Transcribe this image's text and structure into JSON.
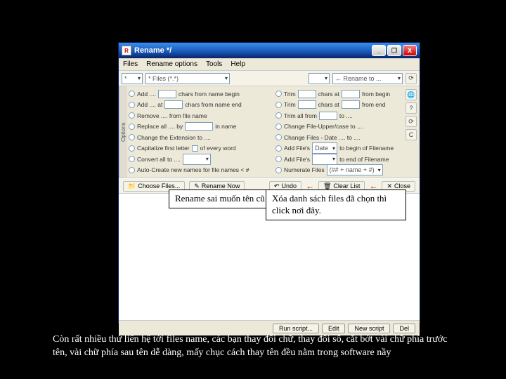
{
  "window": {
    "title": "Rename */",
    "app_icon_glyph": "R"
  },
  "win_buttons": {
    "min": "_",
    "max": "❐",
    "close": "X"
  },
  "menu": {
    "files": "Files",
    "rename_options": "Rename options",
    "tools": "Tools",
    "help": "Help"
  },
  "toolrow": {
    "filter_label": "* Files (*.*)",
    "filter_placeholder": "",
    "rename_label": "← Rename to ..."
  },
  "options_tab": "Options",
  "left_opts": [
    "Add ....",
    "Add .... at",
    "Remove .... from file name",
    "Replace all .... by",
    "Change the Extension to ....",
    "Capitalize first letter",
    "Convert all to ....",
    "Auto-Create new names for file names < #"
  ],
  "left_extras": {
    "chars_begin": "chars from name begin",
    "chars_end": "chars from name end",
    "in_name": "in name",
    "every_word": "of every word"
  },
  "right_opts": [
    "Trim",
    "Trim",
    "Trim all from",
    "Change File-Upper/case to ....",
    "Change Files - Date .... to ....",
    "Add File's",
    "Add File's",
    "Numerate Files"
  ],
  "right_extras": {
    "chars_at": "chars at",
    "from_begin": "from begin",
    "chars_at2": "chars at",
    "from_end": "from end",
    "to": "to ....",
    "begin_filename": "to begin of Filename",
    "end_filename": "to end of Filename",
    "numerate_fmt": "(## + name + #)",
    "date_lbl": "Date"
  },
  "actions": {
    "choose": "Choose Files...",
    "rename_now": "Rename Now",
    "undo": "Undo",
    "clear": "Clear List",
    "close": "Close"
  },
  "side": {
    "a": "🌐",
    "b": "?",
    "c": "⟳",
    "d": "C"
  },
  "callout1": "Rename sai muốn tên cũ thì click nơi",
  "callout2": "Xóa danh sách files đã chọn thì click nơi đây.",
  "bottom": {
    "run": "Run script...",
    "edit": "Edit",
    "new": "New script",
    "del": "Del"
  },
  "caption": "Còn rất nhiều thứ liên hệ tới files name, các bạn thay đổi chữ, thay đổi số, cắt bớt vài chữ phía trước tên, vài chữ phía sau tên dễ dàng, mấy chục cách thay tên đều nằm trong software nầy"
}
